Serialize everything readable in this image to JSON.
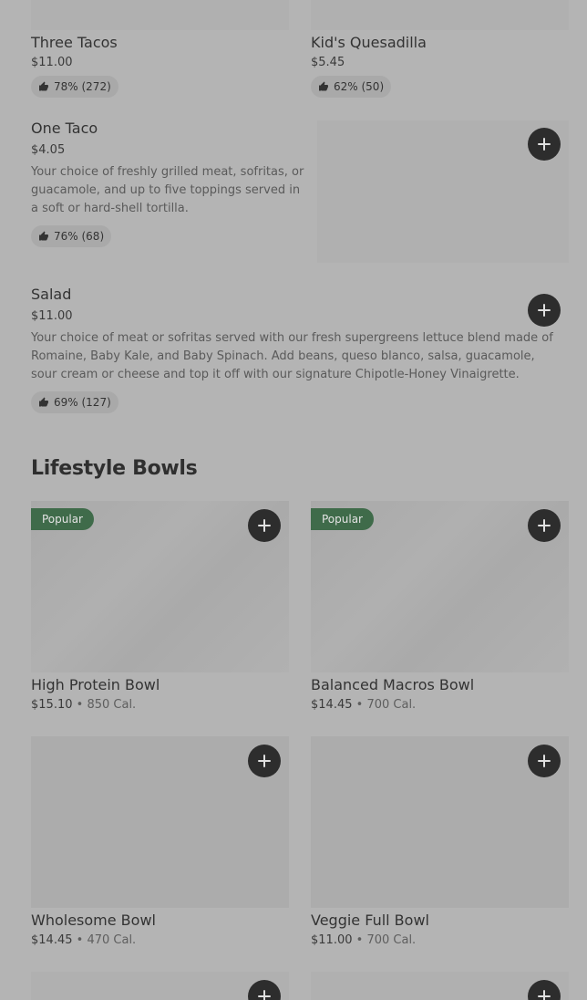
{
  "top_row": [
    {
      "name": "Three Tacos",
      "price": "$11.00",
      "rating": "78% (272)"
    },
    {
      "name": "Kid's Quesadilla",
      "price": "$5.45",
      "rating": "62% (50)"
    }
  ],
  "one_taco": {
    "name": "One Taco",
    "price": "$4.05",
    "description": "Your choice of freshly grilled meat, sofritas, or guacamole, and up to five toppings served in a soft or hard-shell tortilla.",
    "rating": "76% (68)"
  },
  "salad": {
    "name": "Salad",
    "price": "$11.00",
    "description": "Your choice of meat or sofritas served with our fresh supergreens lettuce blend made of Romaine, Baby Kale, and Baby Spinach. Add beans, queso blanco, salsa, guacamole, sour cream or cheese and top it off with our signature Chipotle-Honey Vinaigrette.",
    "rating": "69% (127)"
  },
  "lifestyle": {
    "title": "Lifestyle Bowls",
    "popular_label": "Popular",
    "separator": "•",
    "items": [
      {
        "name": "High Protein Bowl",
        "price": "$15.10",
        "cal": "850 Cal."
      },
      {
        "name": "Balanced Macros Bowl",
        "price": "$14.45",
        "cal": "700 Cal."
      },
      {
        "name": "Wholesome Bowl",
        "price": "$14.45",
        "cal": "470 Cal."
      },
      {
        "name": "Veggie Full Bowl",
        "price": "$11.00",
        "cal": "700 Cal."
      }
    ]
  },
  "icons": {
    "add": "plus-icon",
    "rating": "thumbs-up-icon"
  }
}
